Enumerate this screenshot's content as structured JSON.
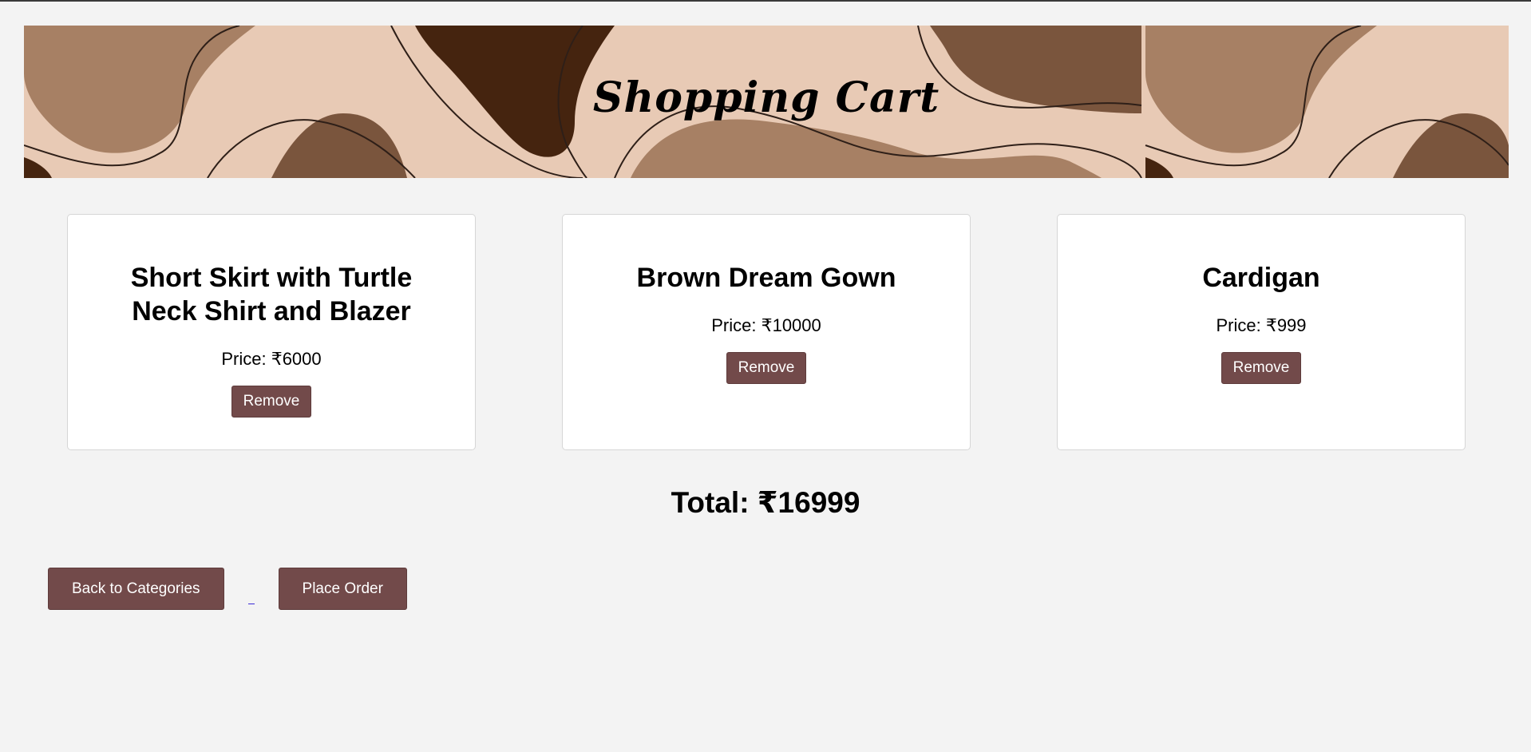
{
  "banner": {
    "title": "Shopping Cart",
    "colors": {
      "light": "#e8cab5",
      "mid": "#a78064",
      "dark": "#7a553d",
      "darkest": "#45240f"
    }
  },
  "cart": {
    "items": [
      {
        "name": "Short Skirt with Turtle Neck Shirt and Blazer",
        "price_label": "Price: ₹6000",
        "remove_label": "Remove"
      },
      {
        "name": "Brown Dream Gown",
        "price_label": "Price: ₹10000",
        "remove_label": "Remove"
      },
      {
        "name": "Cardigan",
        "price_label": "Price: ₹999",
        "remove_label": "Remove"
      }
    ],
    "total_label": "Total: ₹16999"
  },
  "actions": {
    "back_label": "Back to Categories",
    "place_order_label": "Place Order"
  },
  "accent_color": "#724a4a"
}
